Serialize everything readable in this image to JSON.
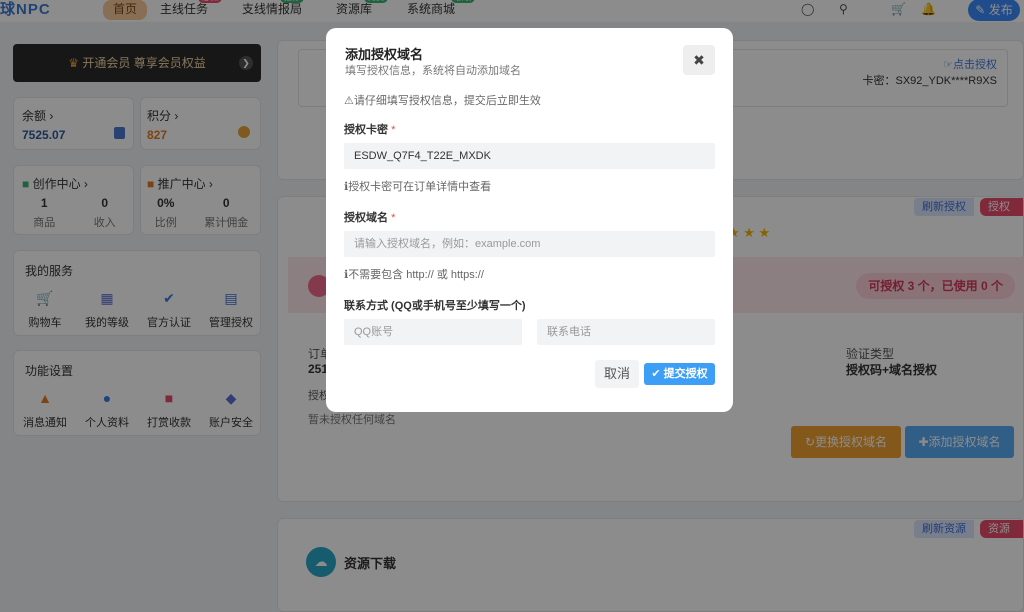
{
  "nav": {
    "logo": "球NPC",
    "items": [
      {
        "label": "首页",
        "badge": ""
      },
      {
        "label": "主线任务",
        "badge": "必做"
      },
      {
        "label": "支线情报局",
        "badge": "推荐"
      },
      {
        "label": "资源库",
        "badge": "免费"
      },
      {
        "label": "系统商城",
        "badge": "领取"
      }
    ],
    "publish": "发布"
  },
  "sidebar": {
    "vip_banner": "开通会员 尊享会员权益",
    "balance_label": "余额 ›",
    "balance_value": "7525.07",
    "points_label": "积分 ›",
    "points_value": "827",
    "creator_title": "创作中心 ›",
    "creator_stats": [
      {
        "value": "1",
        "label": "商品"
      },
      {
        "value": "0",
        "label": "收入"
      }
    ],
    "promo_title": "推广中心 ›",
    "promo_stats": [
      {
        "value": "0%",
        "label": "比例"
      },
      {
        "value": "0",
        "label": "累计佣金"
      }
    ],
    "services_title": "我的服务",
    "services": [
      {
        "label": "购物车",
        "icon": "cart-icon"
      },
      {
        "label": "我的等级",
        "icon": "level-icon"
      },
      {
        "label": "官方认证",
        "icon": "verified-icon"
      },
      {
        "label": "管理授权",
        "icon": "license-icon"
      }
    ],
    "settings_title": "功能设置",
    "settings": [
      {
        "label": "消息通知",
        "icon": "bell-icon"
      },
      {
        "label": "个人资料",
        "icon": "profile-icon"
      },
      {
        "label": "打赏收款",
        "icon": "gift-icon"
      },
      {
        "label": "账户安全",
        "icon": "shield-icon"
      }
    ]
  },
  "main": {
    "click_auth": "点击授权",
    "card_key_line": "卡密：SX92_YDK****R9XS",
    "refresh_auth": "刷新授权",
    "auth_info": "授权信",
    "available_auth": "可授权 3 个，已使用 0 个",
    "verify_type_label": "验证类型",
    "verify_type_value": "授权码+域名授权",
    "order_label": "订单",
    "order_value_partial": "251",
    "auth_label_partial": "授权",
    "no_domain": "暂未授权任何域名",
    "change_domain_btn": "更换授权域名",
    "add_domain_btn": "添加授权域名",
    "refresh_resource": "刷新资源",
    "resource_tag": "资源下",
    "resource_title": "资源下载"
  },
  "modal": {
    "title": "添加授权域名",
    "subtitle": "填写授权信息，系统将自动添加域名",
    "notice": "请仔细填写授权信息，提交后立即生效",
    "card_key_label": "授权卡密",
    "card_key_value": "ESDW_Q7F4_T22E_MXDK",
    "card_key_hint": "授权卡密可在订单详情中查看",
    "domain_label": "授权域名",
    "domain_placeholder": "请输入授权域名，例如：example.com",
    "domain_hint": "不需要包含 http:// 或 https://",
    "contact_label": "联系方式 (QQ或手机号至少填写一个)",
    "qq_placeholder": "QQ账号",
    "phone_placeholder": "联系电话",
    "cancel": "取消",
    "submit": "提交授权"
  }
}
